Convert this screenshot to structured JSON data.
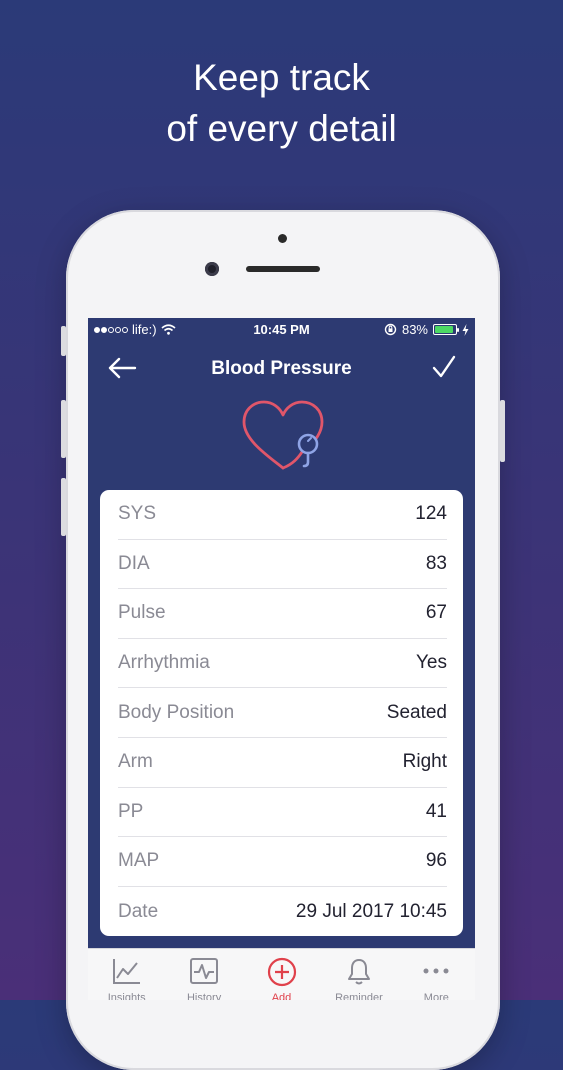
{
  "headline": {
    "line1": "Keep track",
    "line2": "of every detail"
  },
  "status_bar": {
    "carrier": "life:)",
    "time": "10:45 PM",
    "battery_percent": "83%",
    "battery_level": 0.83,
    "signal_dots_filled": 2,
    "signal_dots_total": 5
  },
  "nav": {
    "title": "Blood Pressure",
    "back_icon": "back-arrow-icon",
    "done_icon": "checkmark-icon"
  },
  "hero_icon": "heart-stethoscope-icon",
  "measurements": [
    {
      "label": "SYS",
      "value": "124"
    },
    {
      "label": "DIA",
      "value": "83"
    },
    {
      "label": "Pulse",
      "value": "67"
    },
    {
      "label": "Arrhythmia",
      "value": "Yes"
    },
    {
      "label": "Body Position",
      "value": "Seated"
    },
    {
      "label": "Arm",
      "value": "Right"
    },
    {
      "label": "PP",
      "value": "41"
    },
    {
      "label": "MAP",
      "value": "96"
    },
    {
      "label": "Date",
      "value": "29 Jul 2017 10:45"
    }
  ],
  "tabs": [
    {
      "label": "Insights",
      "icon": "insights-chart-icon",
      "active": false
    },
    {
      "label": "History",
      "icon": "history-pulse-icon",
      "active": false
    },
    {
      "label": "Add",
      "icon": "add-circle-icon",
      "active": true
    },
    {
      "label": "Reminder",
      "icon": "bell-icon",
      "active": false
    },
    {
      "label": "More",
      "icon": "more-dots-icon",
      "active": false
    }
  ],
  "colors": {
    "accent": "#e0414b",
    "app_background": "#2d3a72",
    "battery_fill": "#4cd964",
    "heart_stroke": "#e0566a",
    "stethoscope_stroke": "#8fa4e6"
  }
}
